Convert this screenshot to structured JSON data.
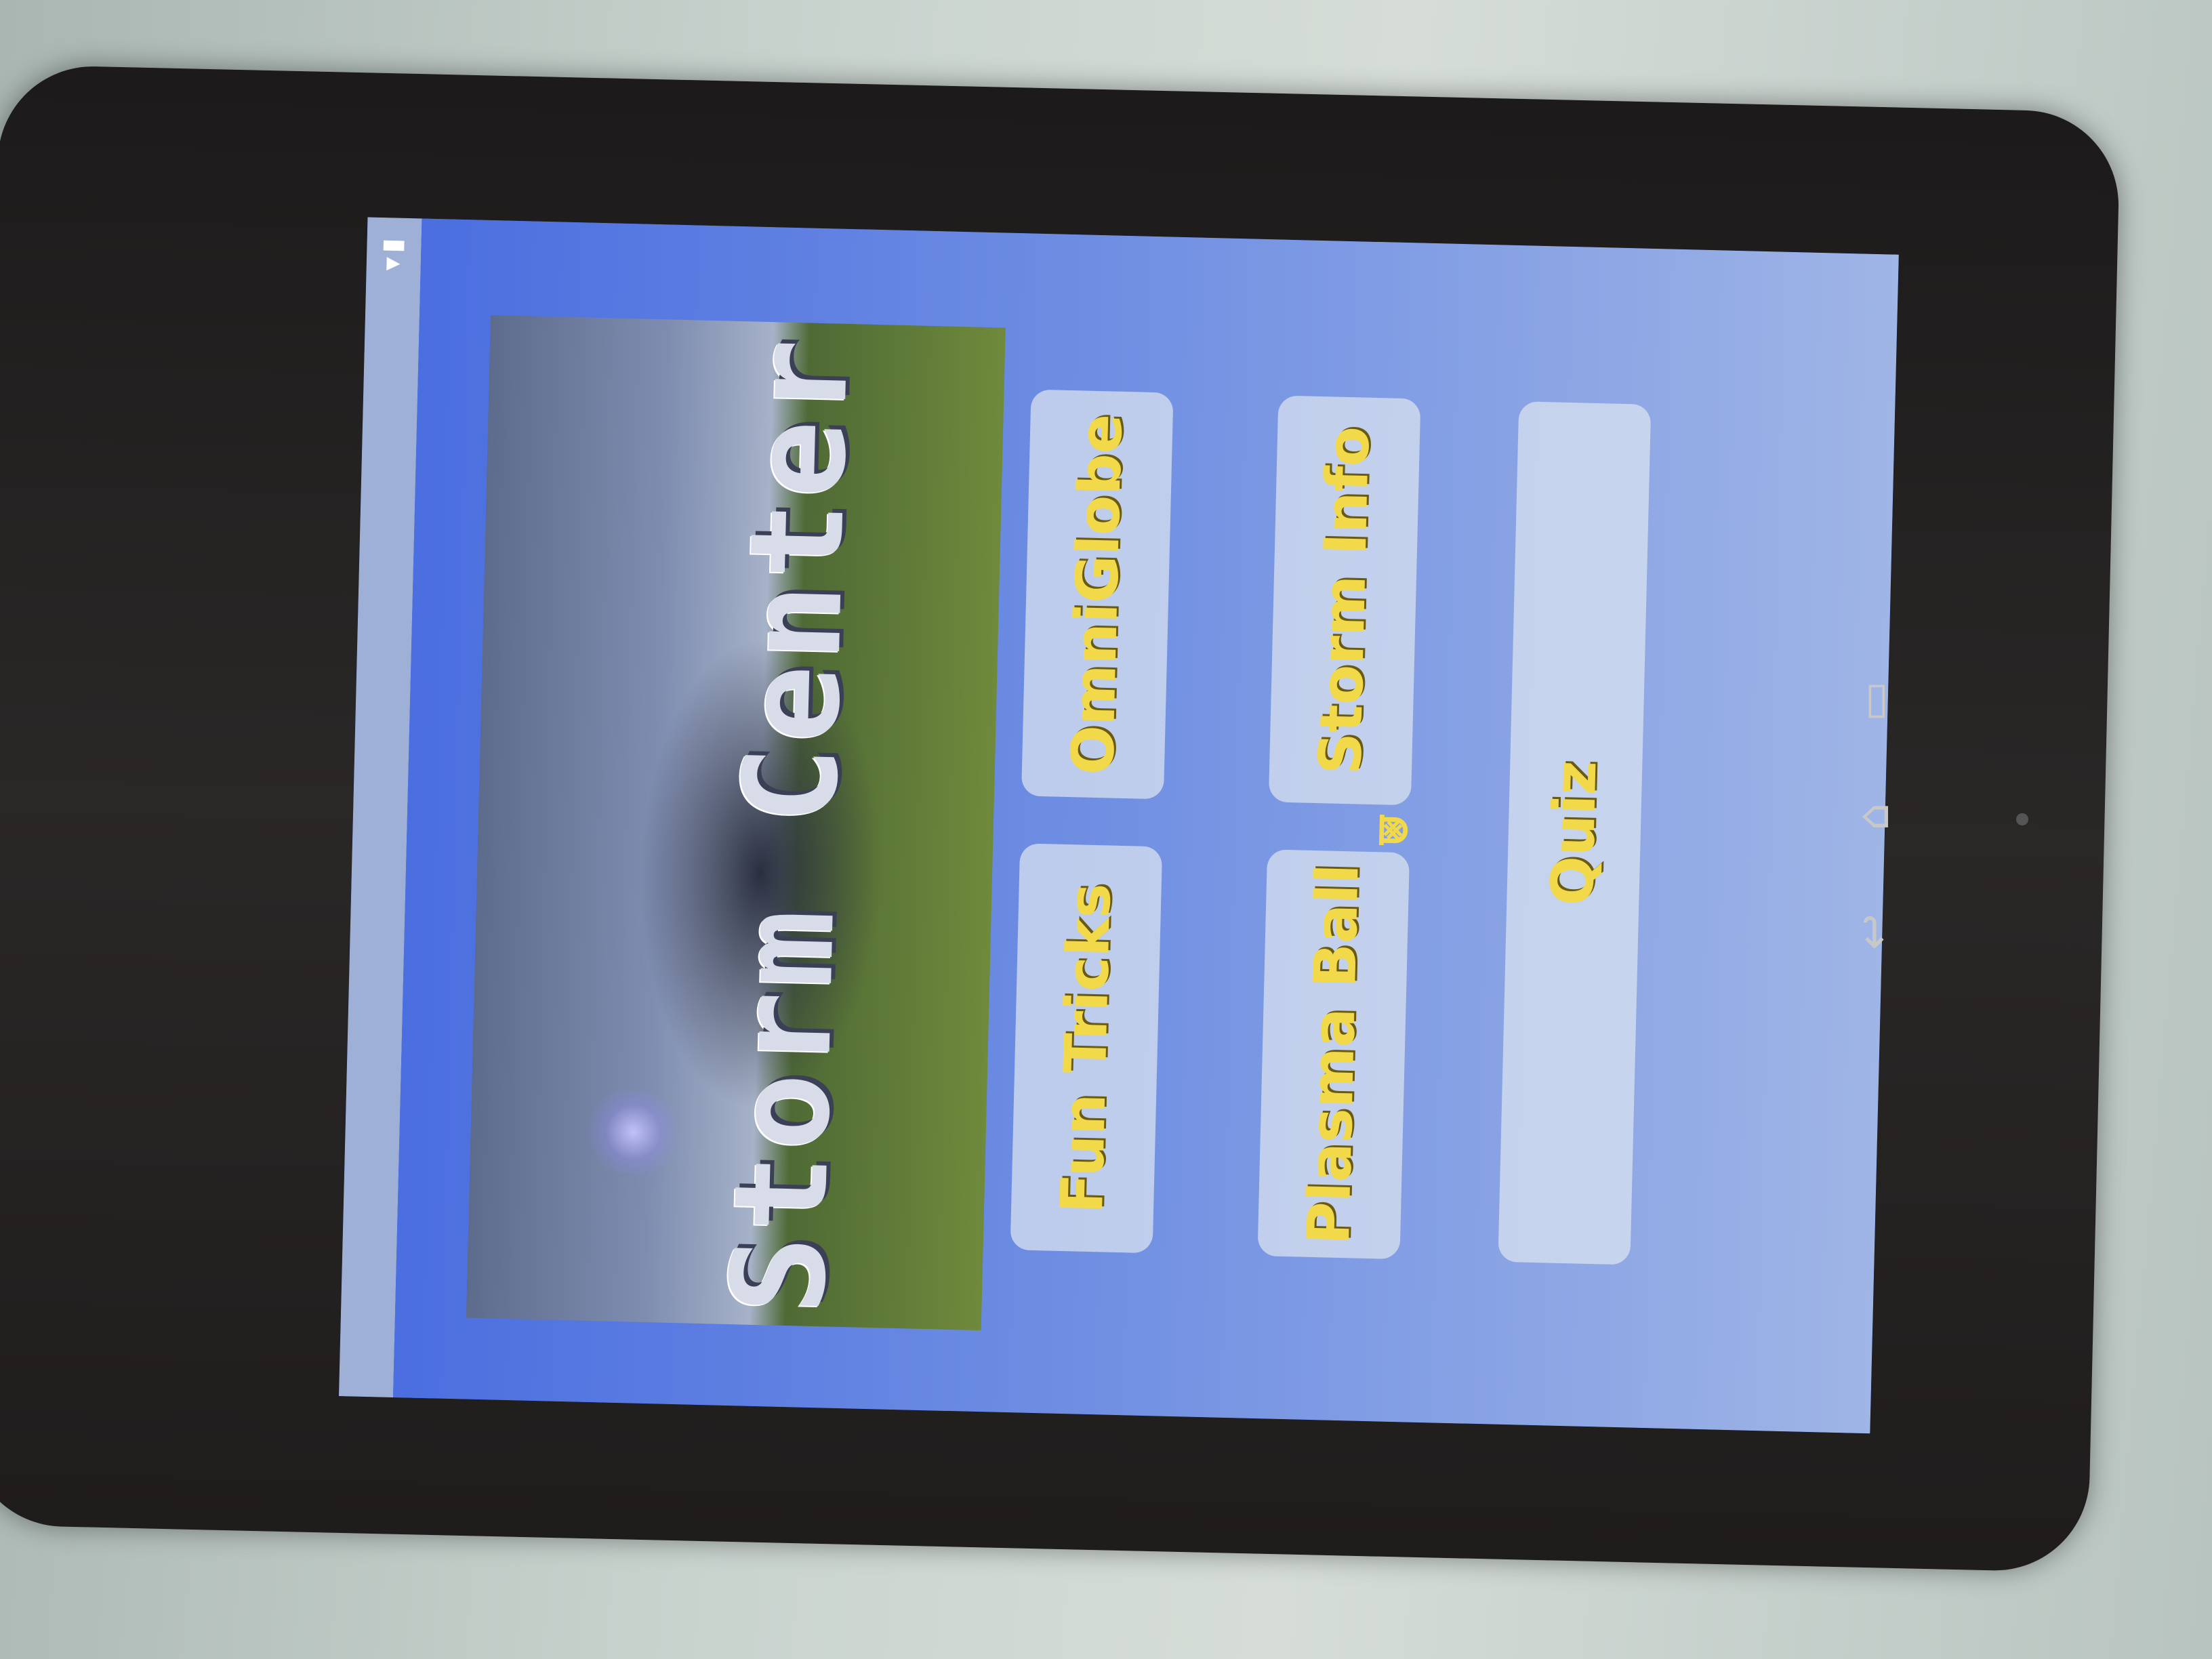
{
  "app": {
    "title": "Storm Center"
  },
  "menu": {
    "fun_tricks": "Fun Tricks",
    "omniglobe": "OmniGlobe",
    "plasma_ball": "Plasma Ball",
    "storm_info": "Storm Info",
    "quiz": "Quiz"
  },
  "status_bar": {
    "icons": "▾▮"
  },
  "footer": {
    "logo_glyph": "⩐"
  },
  "nav": {
    "back_glyph": "↩",
    "home_glyph": "⌂",
    "recent_glyph": "▭"
  },
  "colors": {
    "app_background": "#4a68d8",
    "button_text": "#f2d94a",
    "button_background": "#dce4f0"
  },
  "icons": [
    "back-icon",
    "home-icon",
    "recent-apps-icon",
    "signal-icon",
    "battery-icon"
  ]
}
